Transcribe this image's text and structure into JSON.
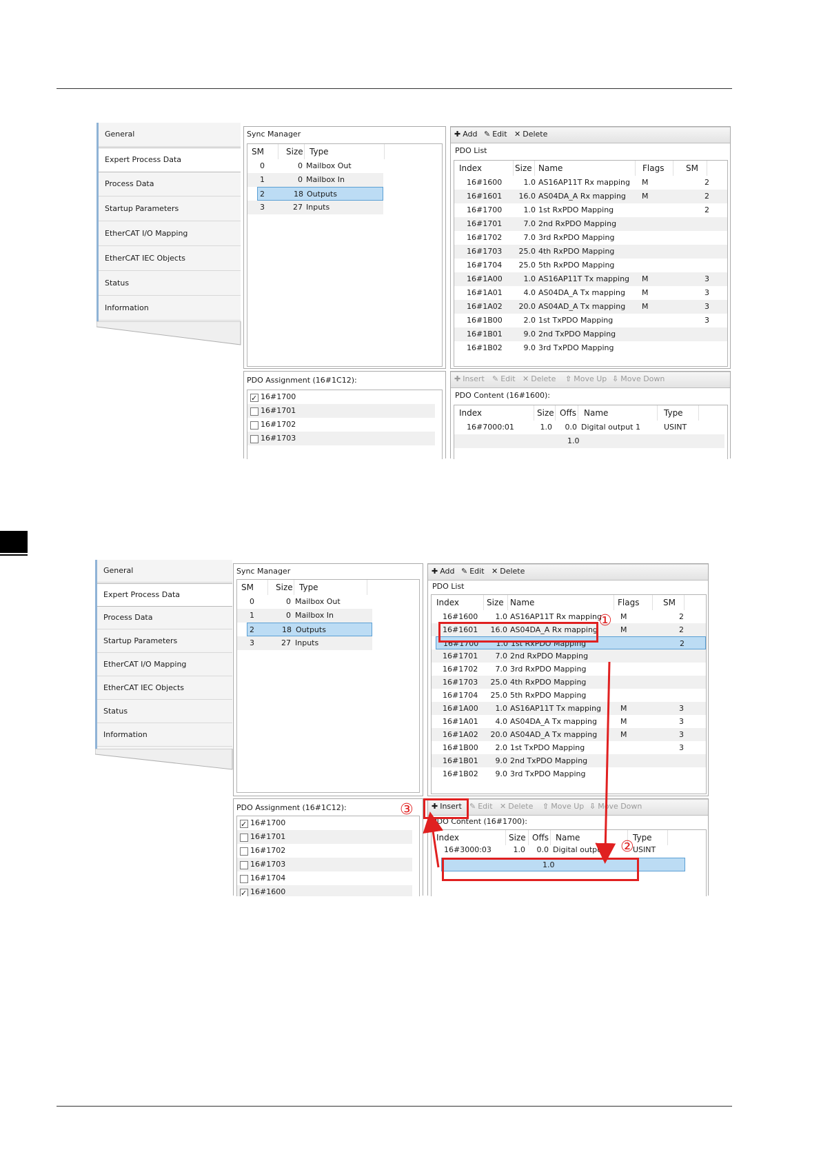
{
  "nav": [
    "General",
    "Expert Process Data",
    "Process Data",
    "Startup Parameters",
    "EtherCAT I/O Mapping",
    "EtherCAT IEC Objects",
    "Status",
    "Information"
  ],
  "sync_manager": {
    "title": "Sync Manager",
    "headers": [
      "SM",
      "Size",
      "Type"
    ],
    "rows": [
      {
        "sm": "0",
        "size": "0",
        "type": "Mailbox Out"
      },
      {
        "sm": "1",
        "size": "0",
        "type": "Mailbox In"
      },
      {
        "sm": "2",
        "size": "18",
        "type": "Outputs"
      },
      {
        "sm": "3",
        "size": "27",
        "type": "Inputs"
      }
    ]
  },
  "pdo_toolbar": {
    "add": "Add",
    "edit": "Edit",
    "delete": "Delete"
  },
  "pdo_list": {
    "title": "PDO List",
    "headers": [
      "Index",
      "Size",
      "Name",
      "Flags",
      "SM"
    ],
    "rows": [
      {
        "index": "16#1600",
        "size": "1.0",
        "name": "AS16AP11T Rx mapping",
        "flags": "M",
        "sm": "2"
      },
      {
        "index": "16#1601",
        "size": "16.0",
        "name": "AS04DA_A Rx mapping",
        "flags": "M",
        "sm": "2"
      },
      {
        "index": "16#1700",
        "size": "1.0",
        "name": "1st RxPDO Mapping",
        "flags": "",
        "sm": "2"
      },
      {
        "index": "16#1701",
        "size": "7.0",
        "name": "2nd RxPDO Mapping",
        "flags": "",
        "sm": ""
      },
      {
        "index": "16#1702",
        "size": "7.0",
        "name": "3rd RxPDO Mapping",
        "flags": "",
        "sm": ""
      },
      {
        "index": "16#1703",
        "size": "25.0",
        "name": "4th RxPDO Mapping",
        "flags": "",
        "sm": ""
      },
      {
        "index": "16#1704",
        "size": "25.0",
        "name": "5th RxPDO Mapping",
        "flags": "",
        "sm": ""
      },
      {
        "index": "16#1A00",
        "size": "1.0",
        "name": "AS16AP11T Tx mapping",
        "flags": "M",
        "sm": "3"
      },
      {
        "index": "16#1A01",
        "size": "4.0",
        "name": "AS04DA_A Tx mapping",
        "flags": "M",
        "sm": "3"
      },
      {
        "index": "16#1A02",
        "size": "20.0",
        "name": "AS04AD_A Tx mapping",
        "flags": "M",
        "sm": "3"
      },
      {
        "index": "16#1B00",
        "size": "2.0",
        "name": "1st TxPDO Mapping",
        "flags": "",
        "sm": "3"
      },
      {
        "index": "16#1B01",
        "size": "9.0",
        "name": "2nd TxPDO Mapping",
        "flags": "",
        "sm": ""
      },
      {
        "index": "16#1B02",
        "size": "9.0",
        "name": "3rd TxPDO Mapping",
        "flags": "",
        "sm": ""
      }
    ]
  },
  "content_toolbar": {
    "insert": "Insert",
    "edit": "Edit",
    "delete": "Delete",
    "move_up": "Move Up",
    "move_down": "Move Down"
  },
  "shot1": {
    "assignment": {
      "title": "PDO Assignment (16#1C12):",
      "items": [
        {
          "label": "16#1700",
          "checked": true
        },
        {
          "label": "16#1701",
          "checked": false
        },
        {
          "label": "16#1702",
          "checked": false
        },
        {
          "label": "16#1703",
          "checked": false
        }
      ]
    },
    "content": {
      "title": "PDO Content (16#1600):",
      "headers": [
        "Index",
        "Size",
        "Offs",
        "Name",
        "Type"
      ],
      "rows": [
        {
          "index": "16#7000:01",
          "size": "1.0",
          "offs": "0.0",
          "name": "Digital output 1",
          "type": "USINT"
        }
      ],
      "total": "1.0"
    }
  },
  "shot2": {
    "assignment": {
      "title": "PDO Assignment (16#1C12):",
      "items": [
        {
          "label": "16#1700",
          "checked": true
        },
        {
          "label": "16#1701",
          "checked": false
        },
        {
          "label": "16#1702",
          "checked": false
        },
        {
          "label": "16#1703",
          "checked": false
        },
        {
          "label": "16#1704",
          "checked": false
        },
        {
          "label": "16#1600",
          "checked": true
        }
      ]
    },
    "content": {
      "title": "PDO Content (16#1700):",
      "headers": [
        "Index",
        "Size",
        "Offs",
        "Name",
        "Type"
      ],
      "rows": [
        {
          "index": "16#3000:03",
          "size": "1.0",
          "offs": "0.0",
          "name": "Digital output",
          "type": "USINT"
        }
      ],
      "total": "1.0"
    },
    "markers": [
      "①",
      "②",
      "③"
    ],
    "annotation_color": "#e02020"
  }
}
